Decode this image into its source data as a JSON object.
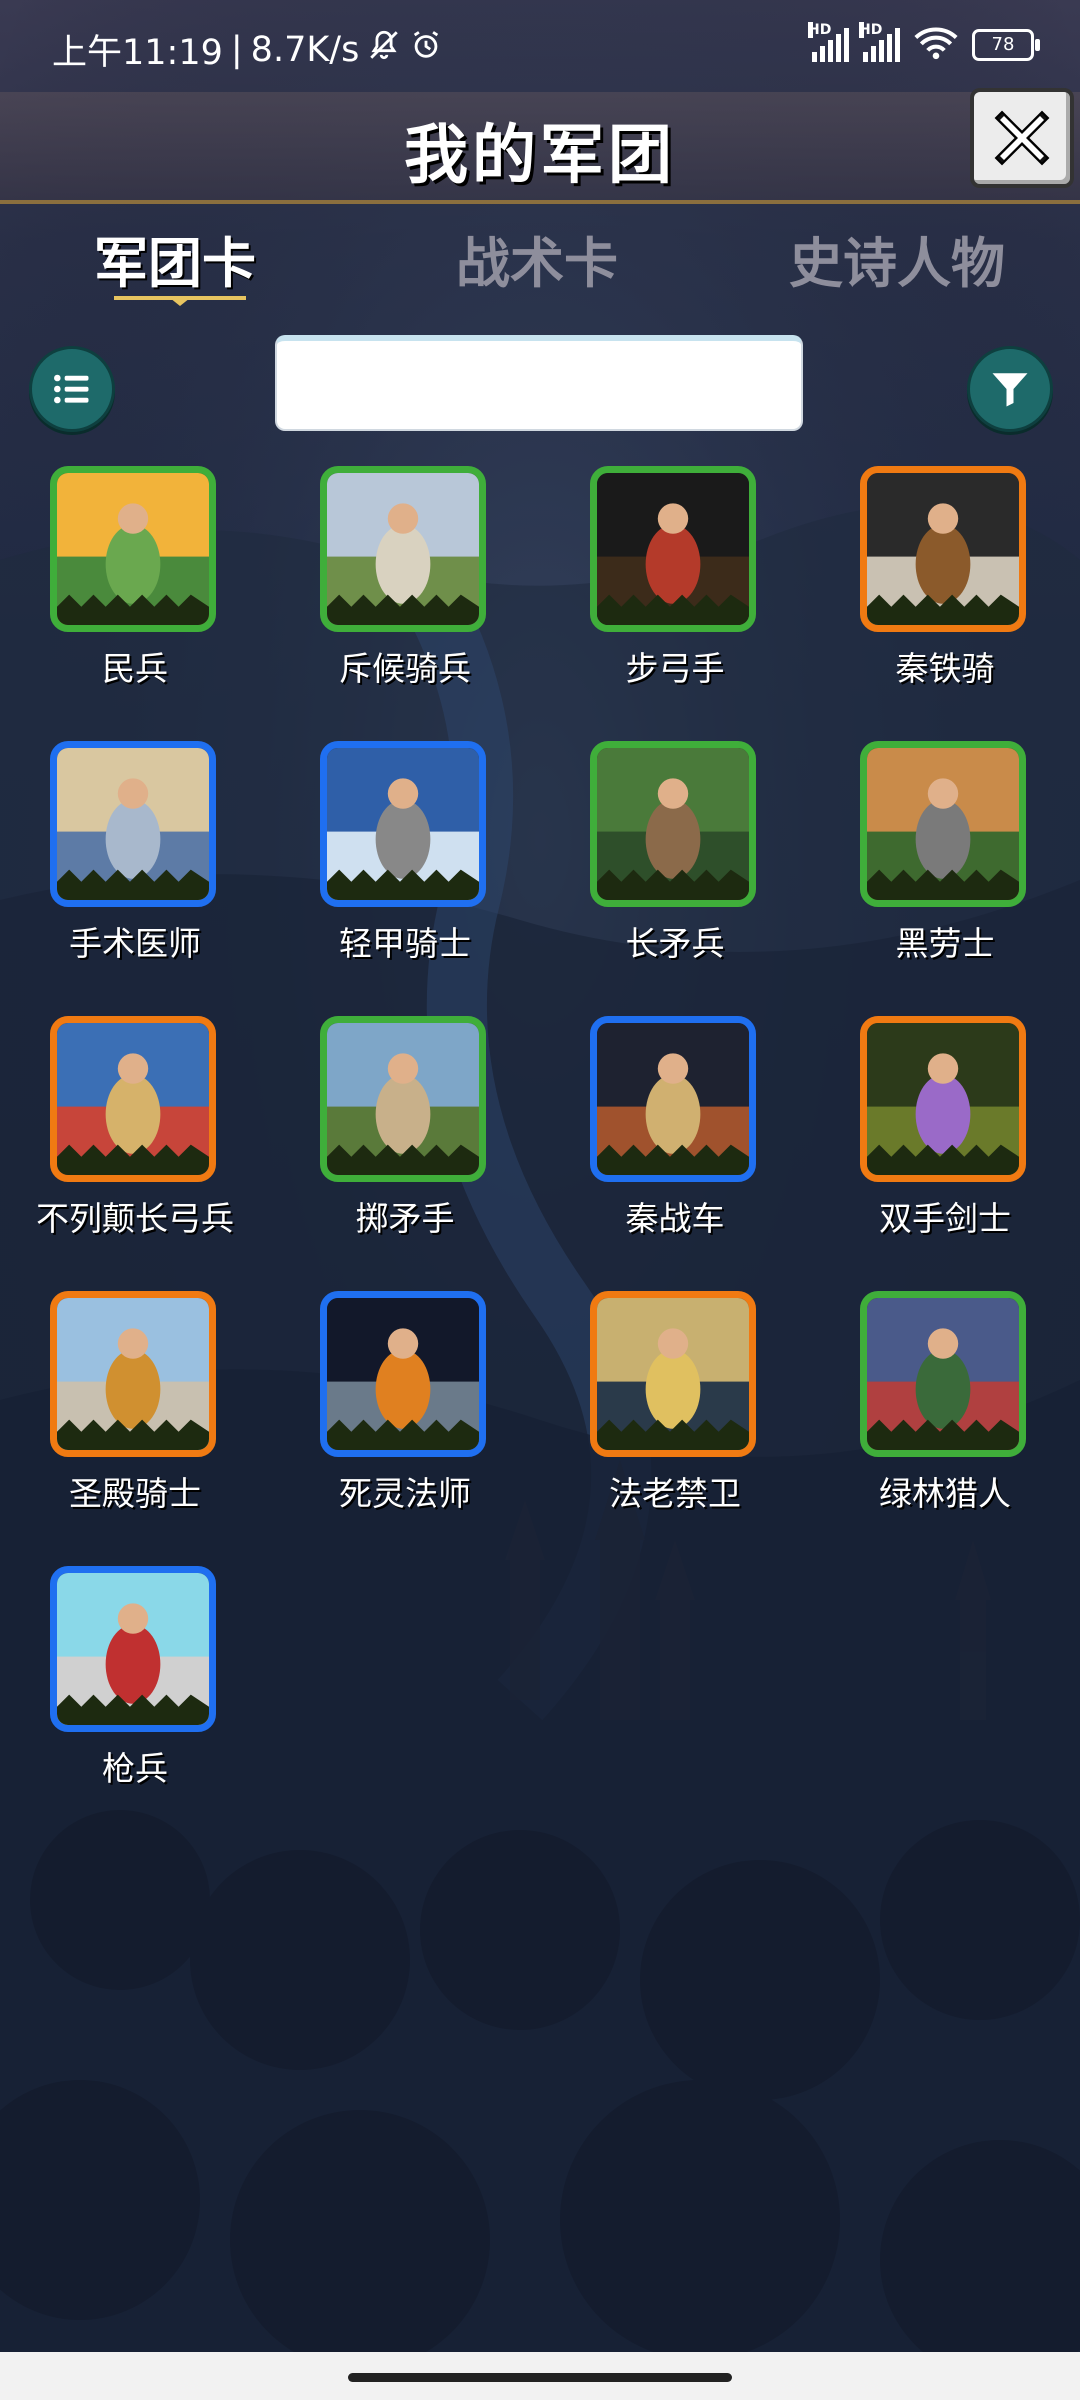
{
  "status": {
    "time": "上午11:19",
    "speed": "8.7K/s",
    "battery": "78",
    "hd1": "HD",
    "hd2": "HD"
  },
  "header": {
    "title": "我的军团"
  },
  "tabs": [
    {
      "label": "军团卡",
      "active": true
    },
    {
      "label": "战术卡",
      "active": false
    },
    {
      "label": "史诗人物",
      "active": false
    }
  ],
  "search": {
    "value": "",
    "placeholder": ""
  },
  "cards": [
    {
      "name": "民兵",
      "rarity": "green"
    },
    {
      "name": "斥候骑兵",
      "rarity": "green"
    },
    {
      "name": "步弓手",
      "rarity": "green"
    },
    {
      "name": "秦铁骑",
      "rarity": "orange"
    },
    {
      "name": "手术医师",
      "rarity": "blue"
    },
    {
      "name": "轻甲骑士",
      "rarity": "blue"
    },
    {
      "name": "长矛兵",
      "rarity": "green"
    },
    {
      "name": "黑劳士",
      "rarity": "green"
    },
    {
      "name": "不列颠长弓兵",
      "rarity": "orange"
    },
    {
      "name": "掷矛手",
      "rarity": "green"
    },
    {
      "name": "秦战车",
      "rarity": "blue"
    },
    {
      "name": "双手剑士",
      "rarity": "orange"
    },
    {
      "name": "圣殿骑士",
      "rarity": "orange"
    },
    {
      "name": "死灵法师",
      "rarity": "blue"
    },
    {
      "name": "法老禁卫",
      "rarity": "orange"
    },
    {
      "name": "绿林猎人",
      "rarity": "green"
    },
    {
      "name": "枪兵",
      "rarity": "blue"
    }
  ],
  "colors": {
    "green": "#3fae3a",
    "blue": "#1f6ff0",
    "orange": "#f07a12",
    "accent": "#1e6a6a"
  }
}
